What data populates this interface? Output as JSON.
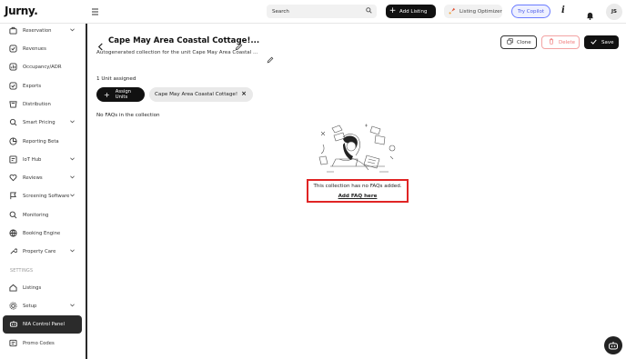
{
  "app": {
    "logo_text": "Jurny."
  },
  "topbar": {
    "search_placeholder": "Search",
    "add_listing_label": "Add Listing",
    "listing_optimizer_label": "Listing Optimizer",
    "try_copilot_label": "Try Copilot",
    "info_label": "i",
    "avatar_initials": "JS"
  },
  "sidebar": {
    "items": [
      {
        "label": "Reservation",
        "icon": "suitcase-icon",
        "has_chevron": true
      },
      {
        "label": "Revenues",
        "icon": "dollar-icon",
        "has_chevron": false
      },
      {
        "label": "Occupancy/ADR",
        "icon": "chart-icon",
        "has_chevron": false
      },
      {
        "label": "Exports",
        "icon": "export-icon",
        "has_chevron": false
      },
      {
        "label": "Distribution",
        "icon": "distribution-icon",
        "has_chevron": false
      },
      {
        "label": "Smart Pricing",
        "icon": "pricing-icon",
        "has_chevron": true
      },
      {
        "label": "Reporting Beta",
        "icon": "report-icon",
        "has_chevron": false
      },
      {
        "label": "IoT Hub",
        "icon": "iot-icon",
        "has_chevron": true
      },
      {
        "label": "Reviews",
        "icon": "heart-icon",
        "has_chevron": true
      },
      {
        "label": "Screening Software",
        "icon": "flag-icon",
        "has_chevron": true
      },
      {
        "label": "Monitoring",
        "icon": "search-icon",
        "has_chevron": false
      },
      {
        "label": "Booking Engine",
        "icon": "globe-icon",
        "has_chevron": false
      },
      {
        "label": "Property Care",
        "icon": "wrench-icon",
        "has_chevron": true
      }
    ],
    "settings_label": "SETTINGS",
    "settings_items": [
      {
        "label": "Listings",
        "icon": "home-icon",
        "has_chevron": false
      },
      {
        "label": "Setup",
        "icon": "gear-icon",
        "has_chevron": true
      },
      {
        "label": "NIA Control Panel",
        "icon": "robot-icon",
        "has_chevron": false,
        "active": true
      },
      {
        "label": "Promo Codes",
        "icon": "promo-icon",
        "has_chevron": false
      }
    ]
  },
  "header": {
    "title": "Cape May Area Coastal Cottage!...",
    "subtitle": "Autogenerated collection for the unit Cape May Area Coastal ...",
    "clone_label": "Clone",
    "delete_label": "Delete",
    "save_label": "Save"
  },
  "units": {
    "assigned_text": "1 Unit assigned",
    "assign_button_label": "Assign Units",
    "chips": [
      "Cape May Area Coastal Cottage!"
    ]
  },
  "faqs": {
    "section_label": "No FAQs in the collection",
    "empty_message": "This collection has no FAQs added.",
    "add_link_label": "Add FAQ here"
  },
  "colors": {
    "accent": "#111111",
    "highlight_border": "#e02424",
    "delete": "#f07a7a",
    "copilot": "#4a5ae8"
  }
}
